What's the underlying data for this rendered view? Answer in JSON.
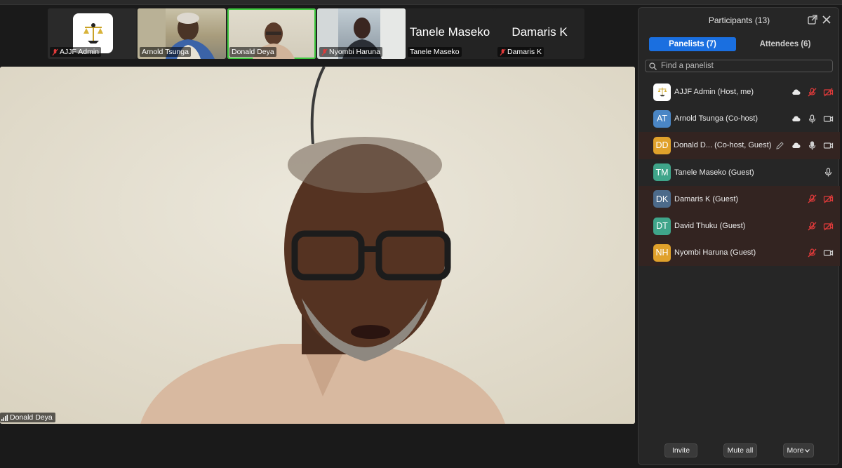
{
  "filmstrip": {
    "tiles": [
      {
        "name": "AJJF Admin",
        "muted": true
      },
      {
        "name": "Arnold Tsunga",
        "muted": false
      },
      {
        "name": "Donald Deya",
        "muted": false
      },
      {
        "name": "Nyombi Haruna",
        "muted": true
      },
      {
        "name": "Tanele Maseko",
        "display": "Tanele Maseko",
        "muted": false
      },
      {
        "name": "Damaris K",
        "display": "Damaris K",
        "muted": true
      }
    ]
  },
  "main_video": {
    "speaker": "Donald Deya"
  },
  "panel": {
    "title": "Participants (13)",
    "tabs": [
      {
        "label": "Panelists (7)",
        "selected": true
      },
      {
        "label": "Attendees (6)",
        "selected": false
      }
    ],
    "search_placeholder": "Find a panelist",
    "participants": [
      {
        "initials": "",
        "name": "AJJF Admin (Host, me)",
        "color": "#ffffff",
        "cloud": true,
        "mic": "muted",
        "video": "off"
      },
      {
        "initials": "AT",
        "name": "Arnold Tsunga (Co-host)",
        "color": "#4a86c5",
        "cloud": true,
        "mic": "on",
        "video": "on"
      },
      {
        "initials": "DD",
        "name": "Donald D...  (Co-host, Guest)",
        "color": "#e0a12b",
        "cloud": true,
        "mic": "on",
        "video": "on",
        "edit": true
      },
      {
        "initials": "TM",
        "name": "Tanele Maseko (Guest)",
        "color": "#3fa58a",
        "cloud": false,
        "mic": "on",
        "video": "none"
      },
      {
        "initials": "DK",
        "name": "Damaris K (Guest)",
        "color": "#4c6a8a",
        "cloud": false,
        "mic": "muted",
        "video": "off"
      },
      {
        "initials": "DT",
        "name": "David Thuku (Guest)",
        "color": "#3fa58a",
        "cloud": false,
        "mic": "muted",
        "video": "off"
      },
      {
        "initials": "NH",
        "name": "Nyombi Haruna (Guest)",
        "color": "#e0a12b",
        "cloud": false,
        "mic": "muted",
        "video": "on"
      }
    ],
    "footer": {
      "invite": "Invite",
      "mute_all": "Mute all",
      "more": "More"
    }
  }
}
